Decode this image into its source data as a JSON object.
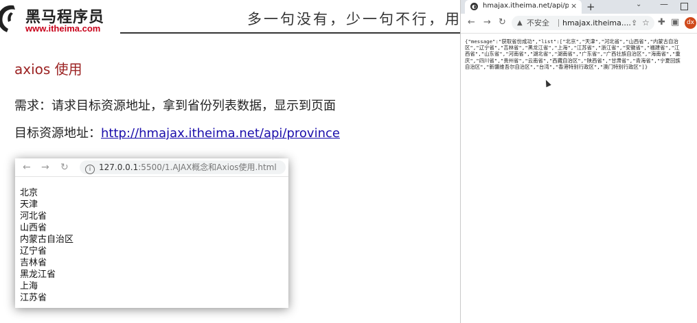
{
  "slide": {
    "logo": {
      "name": "黑马程序员",
      "url": "www.itheima.com"
    },
    "slogan": "多一句没有，少一句不行，用更",
    "title": "axios 使用",
    "requirement": "需求：请求目标资源地址，拿到省份列表数据，显示到页面",
    "resource_label": "目标资源地址：",
    "resource_link": "http://hmajax.itheima.net/api/province",
    "demo_browser": {
      "url_host": "127.0.0.1",
      "url_rest": ":5500/1.AJAX概念和Axios使用.html",
      "provinces": [
        "北京",
        "天津",
        "河北省",
        "山西省",
        "内蒙古自治区",
        "辽宁省",
        "吉林省",
        "黑龙江省",
        "上海",
        "江苏省"
      ]
    }
  },
  "browser": {
    "tab_title": "hmajax.itheima.net/api/provin",
    "close_glyph": "×",
    "new_tab_glyph": "+",
    "insecure_label": "不安全",
    "omnibox_url": "hmajax.itheima....",
    "avatar_initials": "dx",
    "json_lines": [
      "{\"message\":\"获取省份成功\",\"list\":[\"北京\",\"天津\",\"河北省\",\"山西省\",\"内蒙古自治",
      "区\",\"辽宁省\",\"吉林省\",\"黑龙江省\",\"上海\",\"江苏省\",\"浙江省\",\"安徽省\",\"福建省\",\"江",
      "西省\",\"山东省\",\"河南省\",\"湖北省\",\"湖南省\",\"广东省\",\"广西壮族自治区\",\"海南省\",\"重",
      "庆\",\"四川省\",\"贵州省\",\"云南省\",\"西藏自治区\",\"陕西省\",\"甘肃省\",\"青海省\",\"宁夏回族",
      "自治区\",\"新疆维吾尔自治区\",\"台湾\",\"香港特别行政区\",\"澳门特别行政区\"]}"
    ]
  },
  "icons": {
    "back": "back-arrow-icon",
    "forward": "forward-arrow-icon",
    "reload": "reload-icon",
    "info": "info-icon",
    "warning": "warning-icon",
    "share": "share-icon",
    "star": "star-icon",
    "extensions": "puzzle-icon",
    "sidepanel": "side-panel-icon"
  },
  "colors": {
    "title_red": "#9b2222",
    "link_blue": "#1a0dab",
    "avatar_orange": "#d04a1c",
    "logo_red": "#c8001a"
  }
}
